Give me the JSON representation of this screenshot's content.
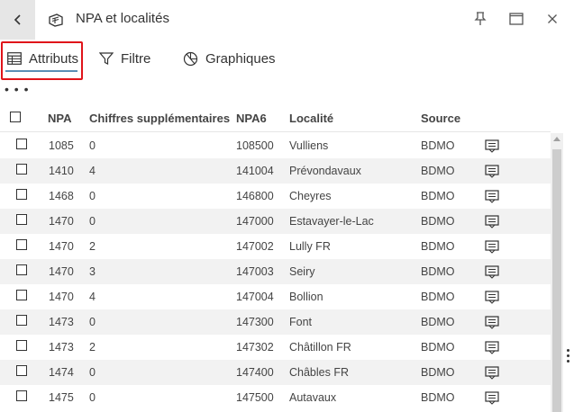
{
  "header": {
    "title": "NPA et localités"
  },
  "tabs": [
    {
      "label": "Attributs",
      "icon": "table-icon",
      "active": true
    },
    {
      "label": "Filtre",
      "icon": "filter-icon",
      "active": false
    },
    {
      "label": "Graphiques",
      "icon": "chart-icon",
      "active": false
    }
  ],
  "more_label": "• • •",
  "table": {
    "columns": [
      "NPA",
      "Chiffres supplémentaires",
      "NPA6",
      "Localité",
      "Source"
    ],
    "rows": [
      {
        "npa": "1085",
        "chiffres": "0",
        "npa6": "108500",
        "localite": "Vulliens",
        "source": "BDMO"
      },
      {
        "npa": "1410",
        "chiffres": "4",
        "npa6": "141004",
        "localite": "Prévondavaux",
        "source": "BDMO"
      },
      {
        "npa": "1468",
        "chiffres": "0",
        "npa6": "146800",
        "localite": "Cheyres",
        "source": "BDMO"
      },
      {
        "npa": "1470",
        "chiffres": "0",
        "npa6": "147000",
        "localite": "Estavayer-le-Lac",
        "source": "BDMO"
      },
      {
        "npa": "1470",
        "chiffres": "2",
        "npa6": "147002",
        "localite": "Lully FR",
        "source": "BDMO"
      },
      {
        "npa": "1470",
        "chiffres": "3",
        "npa6": "147003",
        "localite": "Seiry",
        "source": "BDMO"
      },
      {
        "npa": "1470",
        "chiffres": "4",
        "npa6": "147004",
        "localite": "Bollion",
        "source": "BDMO"
      },
      {
        "npa": "1473",
        "chiffres": "0",
        "npa6": "147300",
        "localite": "Font",
        "source": "BDMO"
      },
      {
        "npa": "1473",
        "chiffres": "2",
        "npa6": "147302",
        "localite": "Châtillon FR",
        "source": "BDMO"
      },
      {
        "npa": "1474",
        "chiffres": "0",
        "npa6": "147400",
        "localite": "Châbles FR",
        "source": "BDMO"
      },
      {
        "npa": "1475",
        "chiffres": "0",
        "npa6": "147500",
        "localite": "Autavaux",
        "source": "BDMO"
      }
    ]
  },
  "colors": {
    "highlight": "#e0141a",
    "tab_underline": "#5a8fb5",
    "row_alt": "#f2f2f2"
  }
}
